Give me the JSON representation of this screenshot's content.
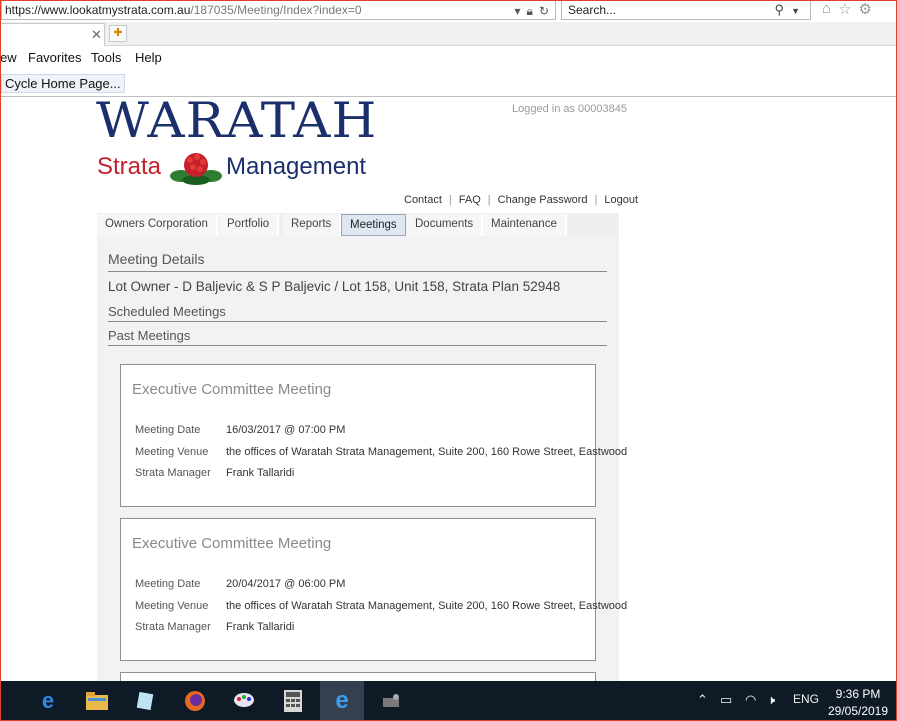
{
  "browser": {
    "url_main": "https://www.lookatmystrata.com.au",
    "url_rest": "/187035/Meeting/Index?index=0",
    "search_placeholder": "Search...",
    "menu": [
      "ew",
      "Favorites",
      "Tools",
      "Help"
    ],
    "favorites_item": "Cycle Home Page..."
  },
  "header": {
    "logo_line1": "WARATAH",
    "logo_strata": "Strata",
    "logo_management": "Management",
    "logged_in": "Logged in as 00003845",
    "links": [
      "Contact",
      "FAQ",
      "Change Password",
      "Logout"
    ]
  },
  "nav": {
    "tabs": [
      "Owners Corporation",
      "Portfolio",
      "Reports",
      "Meetings",
      "Documents",
      "Maintenance"
    ],
    "active": "Meetings"
  },
  "main": {
    "section_title": "Meeting Details",
    "owner_line": "Lot Owner - D Baljevic & S P Baljevic / Lot 158, Unit 158, Strata Plan 52948",
    "scheduled_label": "Scheduled Meetings",
    "past_label": "Past Meetings",
    "meetings": [
      {
        "title": "Executive Committee Meeting",
        "date_label": "Meeting Date",
        "date": "16/03/2017 @ 07:00 PM",
        "venue_label": "Meeting Venue",
        "venue": "the offices of Waratah Strata Management, Suite 200, 160 Rowe Street, Eastwood",
        "manager_label": "Strata Manager",
        "manager": "Frank Tallaridi"
      },
      {
        "title": "Executive Committee Meeting",
        "date_label": "Meeting Date",
        "date": "20/04/2017 @ 06:00 PM",
        "venue_label": "Meeting Venue",
        "venue": "the offices of Waratah Strata Management, Suite 200, 160 Rowe Street, Eastwood",
        "manager_label": "Strata Manager",
        "manager": "Frank Tallaridi"
      }
    ]
  },
  "taskbar": {
    "language": "ENG",
    "time": "9:36 PM",
    "date": "29/05/2019"
  },
  "colors": {
    "brand_navy": "#1b2f6d",
    "brand_red": "#c4212c",
    "taskbar": "#0f1a27"
  }
}
